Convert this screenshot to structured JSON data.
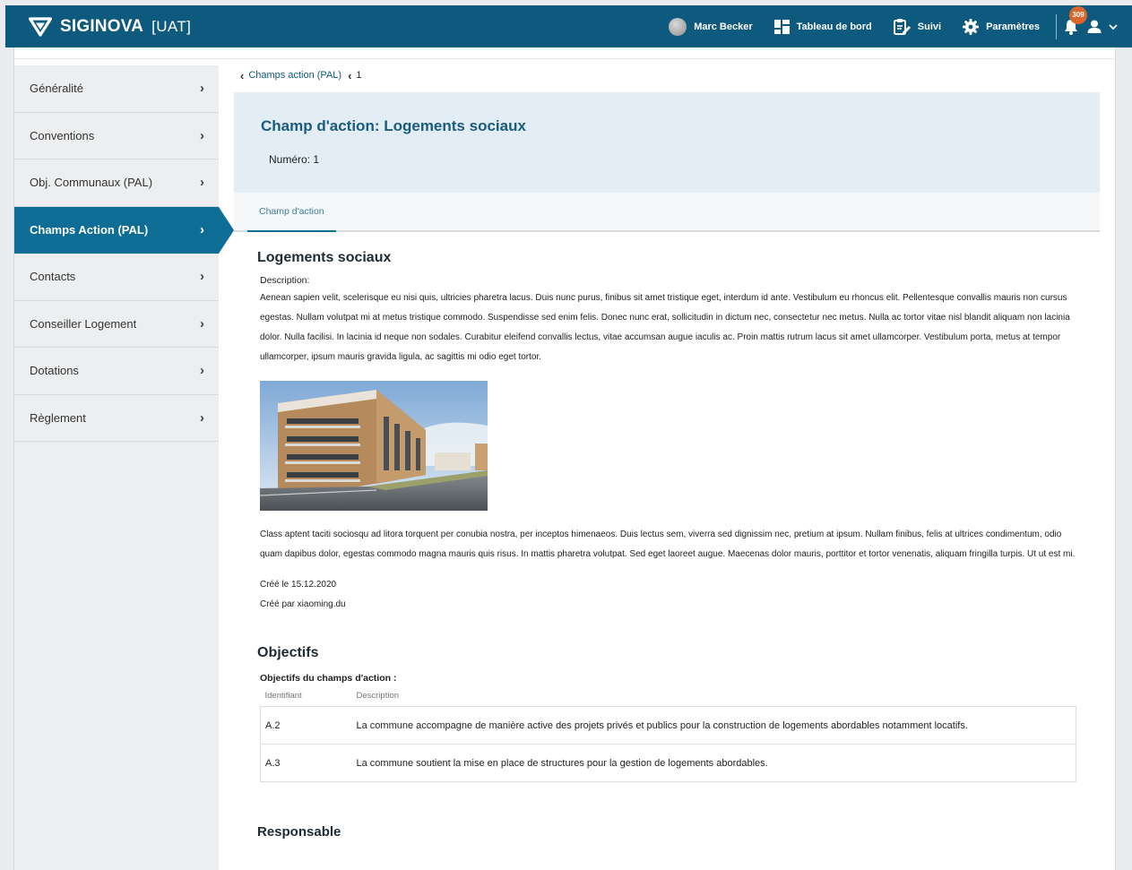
{
  "app": {
    "brand": "SIGINOVA",
    "environment": "[UAT]"
  },
  "topnav": {
    "user_name": "Marc Becker",
    "dashboard_label": "Tableau de bord",
    "tracking_label": "Suivi",
    "settings_label": "Paramètres",
    "notification_count": "309"
  },
  "sidebar": {
    "items": [
      {
        "label": "Généralité"
      },
      {
        "label": "Conventions"
      },
      {
        "label": "Obj. Communaux (PAL)"
      },
      {
        "label": "Champs Action (PAL)"
      },
      {
        "label": "Contacts"
      },
      {
        "label": "Conseiller Logement"
      },
      {
        "label": "Dotations"
      },
      {
        "label": "Règlement"
      }
    ],
    "active_index": 3
  },
  "breadcrumb": {
    "parent": "Champs action (PAL)",
    "current": "1"
  },
  "header": {
    "title": "Champ d'action: Logements sociaux",
    "number": "Numéro: 1"
  },
  "tabs": {
    "active": "Champ d'action"
  },
  "detail": {
    "name": "Logements sociaux",
    "description_label": "Description:",
    "description_text": "Aenean sapien velit, scelerisque eu nisi quis, ultricies pharetra lacus. Duis nunc purus, finibus sit amet tristique eget, interdum id ante. Vestibulum eu rhoncus elit. Pellentesque convallis mauris non cursus egestas. Nullam volutpat mi at metus tristique commodo. Suspendisse sed enim felis. Donec nunc erat, sollicitudin in dictum nec, consectetur nec metus. Nulla ac tortor vitae nisl blandit aliquam non lacinia dolor. Nulla facilisi. In lacinia id neque non sodales. Curabitur eleifend convallis lectus, vitae accumsan augue iaculis ac. Proin mattis rutrum lacus sit amet ullamcorper. Vestibulum porta, metus at tempor ullamcorper, ipsum mauris gravida ligula, ac sagittis mi odio eget tortor.",
    "second_text": "Class aptent taciti sociosqu ad litora torquent per conubia nostra, per inceptos himenaeos. Duis lectus sem, viverra sed dignissim nec, pretium at ipsum. Nullam finibus, felis at ultrices condimentum, odio quam dapibus dolor, egestas commodo magna mauris quis risus. In mattis pharetra volutpat. Sed eget laoreet augue. Maecenas dolor mauris, porttitor et tortor venenatis, aliquam fringilla turpis. Ut ut est mi.",
    "created_on": "Créé le 15.12.2020",
    "created_by": "Créé par xiaoming.du"
  },
  "objectives": {
    "title": "Objectifs",
    "subtitle": "Objectifs du champs d'action :",
    "col_id": "Identifiant",
    "col_desc": "Description",
    "rows": [
      {
        "id": "A.2",
        "description": "La commune accompagne de manière active des projets privés et publics pour la construction de logements abordables notamment locatifs."
      },
      {
        "id": "A.3",
        "description": "La commune soutient la mise en place de structures pour la gestion de logements abordables."
      }
    ]
  },
  "responsable": {
    "title": "Responsable"
  },
  "colors": {
    "topbar": "#0d5a7e",
    "accent": "#0d6d94",
    "header_bg": "#e2edf6",
    "badge": "#d9652a"
  }
}
